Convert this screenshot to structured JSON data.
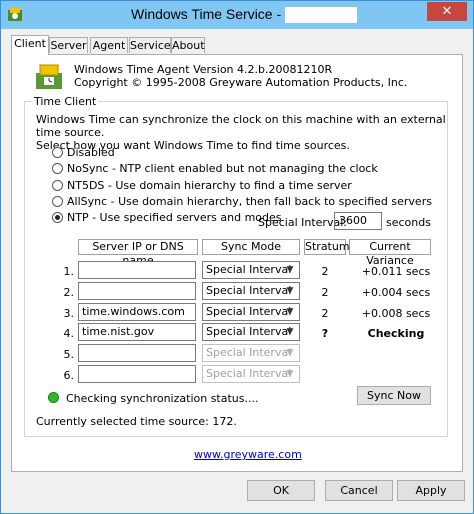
{
  "window": {
    "title": "Windows Time Service -",
    "close_glyph": "✕"
  },
  "tabs": [
    {
      "label": "Client",
      "active": true
    },
    {
      "label": "Server",
      "active": false
    },
    {
      "label": "Agent",
      "active": false
    },
    {
      "label": "Service",
      "active": false
    },
    {
      "label": "About",
      "active": false
    }
  ],
  "about": {
    "version": "Windows Time Agent Version 4.2.b.20081210R",
    "copyright": "Copyright © 1995-2008 Greyware Automation Products, Inc."
  },
  "time_client": {
    "legend": "Time Client",
    "description_line1": "Windows Time can synchronize the clock on this machine with an external time source.",
    "description_line2": "Select how you want Windows Time to find time sources.",
    "options": [
      {
        "label": "Disabled",
        "selected": false
      },
      {
        "label": "NoSync - NTP client enabled but not managing the clock",
        "selected": false
      },
      {
        "label": "NT5DS - Use domain hierarchy to find a time server",
        "selected": false
      },
      {
        "label": "AllSync - Use domain hierarchy, then fall back to specified servers",
        "selected": false
      },
      {
        "label": "NTP - Use specified servers and modes",
        "selected": true
      }
    ],
    "special_interval_label": "Special Interval:",
    "special_interval_value": "3600",
    "special_interval_unit": "seconds"
  },
  "server_table": {
    "headers": {
      "server": "Server IP or DNS name",
      "mode": "Sync Mode",
      "stratum": "Stratum",
      "variance": "Current Variance"
    },
    "rows": [
      {
        "num": "1.",
        "server": "",
        "mode": "Special Interval",
        "enabled": true,
        "stratum": "2",
        "variance": "+0.011 secs",
        "bold": false
      },
      {
        "num": "2.",
        "server": "",
        "mode": "Special Interval",
        "enabled": true,
        "stratum": "2",
        "variance": "+0.004 secs",
        "bold": false
      },
      {
        "num": "3.",
        "server": "time.windows.com",
        "mode": "Special Interval",
        "enabled": true,
        "stratum": "2",
        "variance": "+0.008 secs",
        "bold": false
      },
      {
        "num": "4.",
        "server": "time.nist.gov",
        "mode": "Special Interval",
        "enabled": true,
        "stratum": "?",
        "variance": "Checking",
        "bold": true
      },
      {
        "num": "5.",
        "server": "",
        "mode": "Special Interval",
        "enabled": false,
        "stratum": "",
        "variance": "",
        "bold": false
      },
      {
        "num": "6.",
        "server": "",
        "mode": "Special Interval",
        "enabled": false,
        "stratum": "",
        "variance": "",
        "bold": false
      }
    ]
  },
  "status": {
    "text": "Checking synchronization status....",
    "color": "#2db82d"
  },
  "sync_now_label": "Sync Now",
  "current_source": "Currently selected time source:  172.",
  "link": "www.greyware.com",
  "footer": {
    "ok": "OK",
    "cancel": "Cancel",
    "apply": "Apply"
  }
}
